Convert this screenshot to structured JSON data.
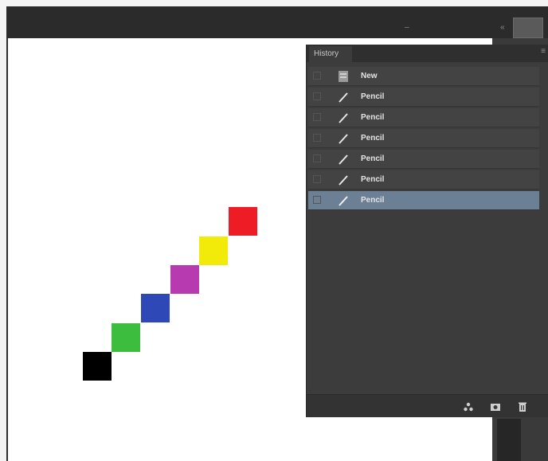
{
  "window": {
    "minimize_glyph": "–",
    "collapse_glyph": "«"
  },
  "history_panel": {
    "tab_label": "History",
    "menu_glyph": "≡",
    "items": [
      {
        "label": "New",
        "icon": "document-snapshot-icon",
        "selected": false
      },
      {
        "label": "Pencil",
        "icon": "pencil-icon",
        "selected": false
      },
      {
        "label": "Pencil",
        "icon": "pencil-icon",
        "selected": false
      },
      {
        "label": "Pencil",
        "icon": "pencil-icon",
        "selected": false
      },
      {
        "label": "Pencil",
        "icon": "pencil-icon",
        "selected": false
      },
      {
        "label": "Pencil",
        "icon": "pencil-icon",
        "selected": false
      },
      {
        "label": "Pencil",
        "icon": "pencil-icon",
        "selected": true
      }
    ],
    "footer_buttons": [
      "new-document-from-state-icon",
      "create-snapshot-icon",
      "trash-icon"
    ]
  },
  "canvas": {
    "pixels": [
      {
        "name": "black-pixel",
        "color": "#000000"
      },
      {
        "name": "green-pixel",
        "color": "#3dbd3d"
      },
      {
        "name": "blue-pixel",
        "color": "#2f48b8"
      },
      {
        "name": "magenta-pixel",
        "color": "#b83ab0"
      },
      {
        "name": "yellow-pixel",
        "color": "#f2ea08"
      },
      {
        "name": "red-pixel",
        "color": "#ee1c24"
      }
    ]
  },
  "colors": {
    "panel_bg": "#3c3c3c",
    "selected_row": "#6b7f95",
    "topbar": "#2b2b2b"
  }
}
